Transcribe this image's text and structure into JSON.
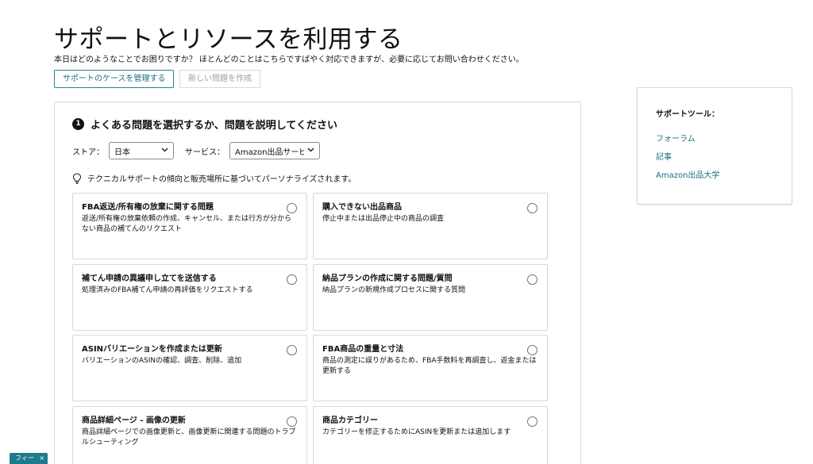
{
  "header": {
    "title": "サポートとリソースを利用する",
    "subtitle": "本日はどのようなことでお困りですか？ ほとんどのことはこちらですばやく対応できますが、必要に応じてお問い合わせください。"
  },
  "actions": {
    "manage_cases": "サポートのケースを管理する",
    "new_issue": "新しい問題を作成"
  },
  "step": {
    "number": "1",
    "title": "よくある問題を選択するか、問題を説明してください"
  },
  "filters": {
    "store_label": "ストア：",
    "store_value": "日本",
    "service_label": "サービス：",
    "service_value": "Amazon出品サービ"
  },
  "hint": "テクニカルサポートの傾向と販売場所に基づいてパーソナライズされます。",
  "cards": [
    {
      "title": "FBA返送/所有権の放棄に関する問題",
      "desc": "返送/所有権の放棄依頼の作成、キャンセル、または行方が分からない商品の補てんのリクエスト"
    },
    {
      "title": "購入できない出品商品",
      "desc": "停止中または出品停止中の商品の調査"
    },
    {
      "title": "補てん申請の異議申し立てを送信する",
      "desc": "処理済みのFBA補てん申請の再評価をリクエストする"
    },
    {
      "title": "納品プランの作成に関する問題/質問",
      "desc": "納品プランの新規作成プロセスに関する質問"
    },
    {
      "title": "ASINバリエーションを作成または更新",
      "desc": "バリエーションのASINの確認、調査、削除、追加"
    },
    {
      "title": "FBA商品の重量と寸法",
      "desc": "商品の測定に誤りがあるため、FBA手数料を再調査し、返金または更新する"
    },
    {
      "title": "商品詳細ページ - 画像の更新",
      "desc": "商品詳細ページでの画像更新と、画像更新に関連する問題のトラブルシューティング"
    },
    {
      "title": "商品カテゴリー",
      "desc": "カテゴリーを修正するためにASINを更新または追加します"
    }
  ],
  "side": {
    "title": "サポートツール：",
    "links": [
      "フォーラム",
      "記事",
      "Amazon出品大学"
    ]
  },
  "feedback": {
    "label": "フィー",
    "close": "×"
  },
  "colors": {
    "accent": "#1e6f80",
    "border": "#d5d9d9",
    "feedback_bg": "#1f7a8c"
  }
}
